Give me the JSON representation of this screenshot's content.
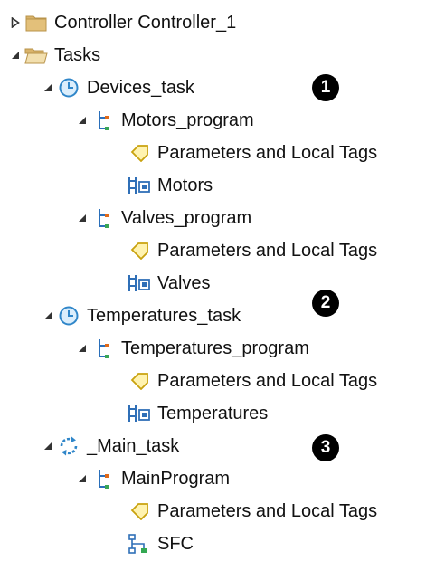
{
  "tree": {
    "controller": {
      "label": "Controller Controller_1",
      "expanded": false,
      "icon": "folder-icon"
    },
    "tasks": {
      "label": "Tasks",
      "expanded": true,
      "icon": "open-folder-icon"
    },
    "devices_task": {
      "label": "Devices_task",
      "icon": "periodic-task-clock-icon",
      "badge": "1",
      "motors_program": {
        "label": "Motors_program",
        "icon": "program-icon",
        "tags": {
          "label": "Parameters and Local Tags",
          "icon": "tag-icon"
        },
        "routine": {
          "label": "Motors",
          "icon": "ladder-routine-icon"
        }
      },
      "valves_program": {
        "label": "Valves_program",
        "icon": "program-icon",
        "tags": {
          "label": "Parameters and Local Tags",
          "icon": "tag-icon"
        },
        "routine": {
          "label": "Valves",
          "icon": "ladder-routine-icon"
        }
      }
    },
    "temperatures_task": {
      "label": "Temperatures_task",
      "icon": "periodic-task-clock-icon",
      "badge": "2",
      "temperatures_program": {
        "label": "Temperatures_program",
        "icon": "program-icon",
        "tags": {
          "label": "Parameters and Local Tags",
          "icon": "tag-icon"
        },
        "routine": {
          "label": "Temperatures",
          "icon": "ladder-routine-icon"
        }
      }
    },
    "main_task": {
      "label": "_Main_task",
      "icon": "continuous-task-icon",
      "badge": "3",
      "main_program": {
        "label": "MainProgram",
        "icon": "program-icon",
        "tags": {
          "label": "Parameters and Local Tags",
          "icon": "tag-icon"
        },
        "routine": {
          "label": "SFC",
          "icon": "sfc-routine-icon"
        }
      }
    }
  },
  "colors": {
    "folder": "#d9b36a",
    "clock": "#2f86c9",
    "tag": "#e8c21a",
    "program": "#2a6fba",
    "routine": "#2f6fb7",
    "sfc": "#34a853",
    "badge": "#000000"
  }
}
